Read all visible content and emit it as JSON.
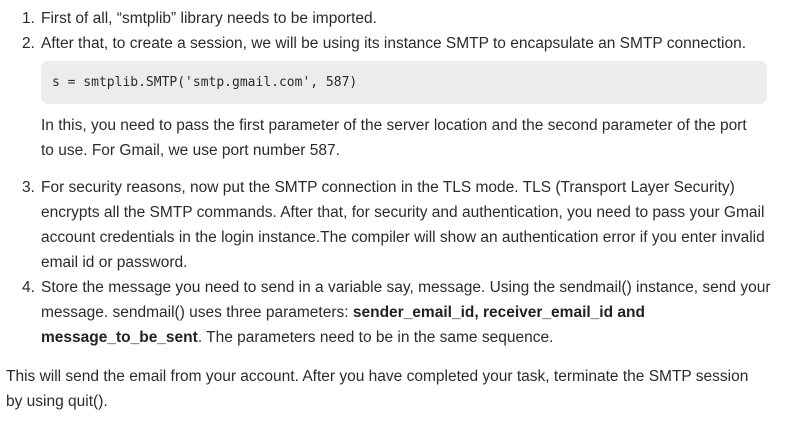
{
  "steps": [
    {
      "number": "1.",
      "text": "First of all, “smtplib” library needs to be imported."
    },
    {
      "number": "2.",
      "text": "After that, to create a session, we will be using its instance SMTP to encapsulate an SMTP connection.",
      "code": "s = smtplib.SMTP('smtp.gmail.com', 587)",
      "note": "In this, you need to pass the first parameter of the server location and the second parameter of the port to use. For Gmail, we use port number 587."
    },
    {
      "number": "3.",
      "text": "For security reasons, now put the SMTP connection in the TLS mode. TLS (Transport Layer Security) encrypts all the SMTP commands. After that, for security and authentication, you need to pass your Gmail account credentials in the login instance.The compiler will show an authentication error if you enter invalid email id or password."
    },
    {
      "number": "4.",
      "text_before": "Store the message you need to send in a variable say, message. Using the sendmail() instance, send your message. sendmail() uses three parameters: ",
      "bold": "sender_email_id, receiver_email_id and message_to_be_sent",
      "text_after": ". The parameters need to be in the same sequence."
    }
  ],
  "closing": "This will send the email from your account. After you have completed your task, terminate the SMTP session by using quit()."
}
